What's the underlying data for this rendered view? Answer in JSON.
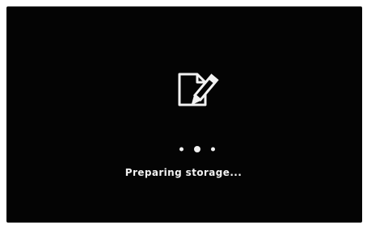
{
  "screen": {
    "background_color": "#040404",
    "icon": "storage-edit-icon",
    "loading_indicator": {
      "dots": 3,
      "active_index": 1
    },
    "status_text": "Preparing storage..."
  }
}
